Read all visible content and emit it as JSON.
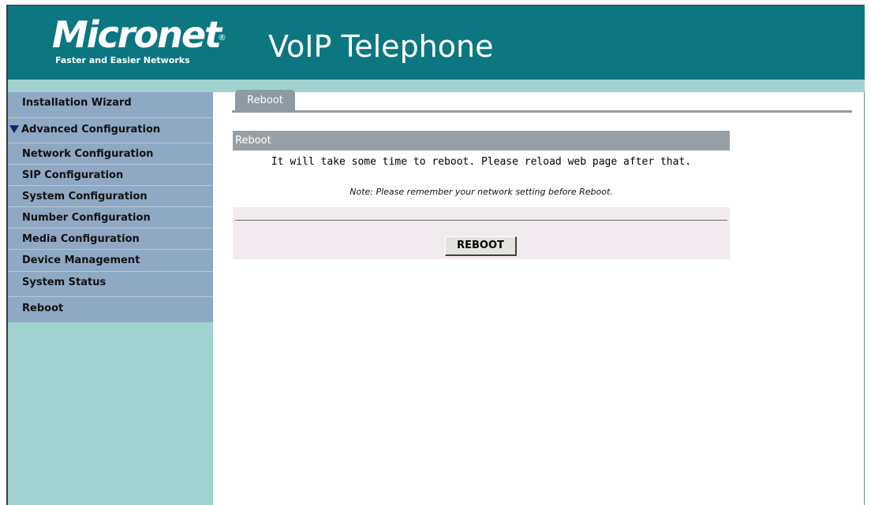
{
  "header": {
    "logo_text": "Micronet",
    "logo_reg": "®",
    "logo_tagline": "Faster and Easier Networks",
    "title": "VoIP Telephone"
  },
  "sidebar": {
    "items": [
      {
        "label": "Installation Wizard"
      },
      {
        "label": "Advanced Configuration",
        "icon": "triangle-down-icon"
      },
      {
        "label": "Network Configuration"
      },
      {
        "label": "SIP Configuration"
      },
      {
        "label": "System Configuration"
      },
      {
        "label": "Number Configuration"
      },
      {
        "label": "Media Configuration"
      },
      {
        "label": "Device Management"
      },
      {
        "label": "System Status"
      },
      {
        "label": "Reboot"
      }
    ]
  },
  "tab": {
    "label": "Reboot"
  },
  "panel": {
    "title": "Reboot",
    "message": "It will take some time to reboot. Please reload web page after that.",
    "note": "Note: Please remember your network setting before Reboot.",
    "button_label": "REBOOT"
  },
  "colors": {
    "header": "#0c7781",
    "sidebar_bg": "#a0d2cf",
    "nav_bg": "#8fa8c3",
    "tab": "#8e9aa3"
  }
}
